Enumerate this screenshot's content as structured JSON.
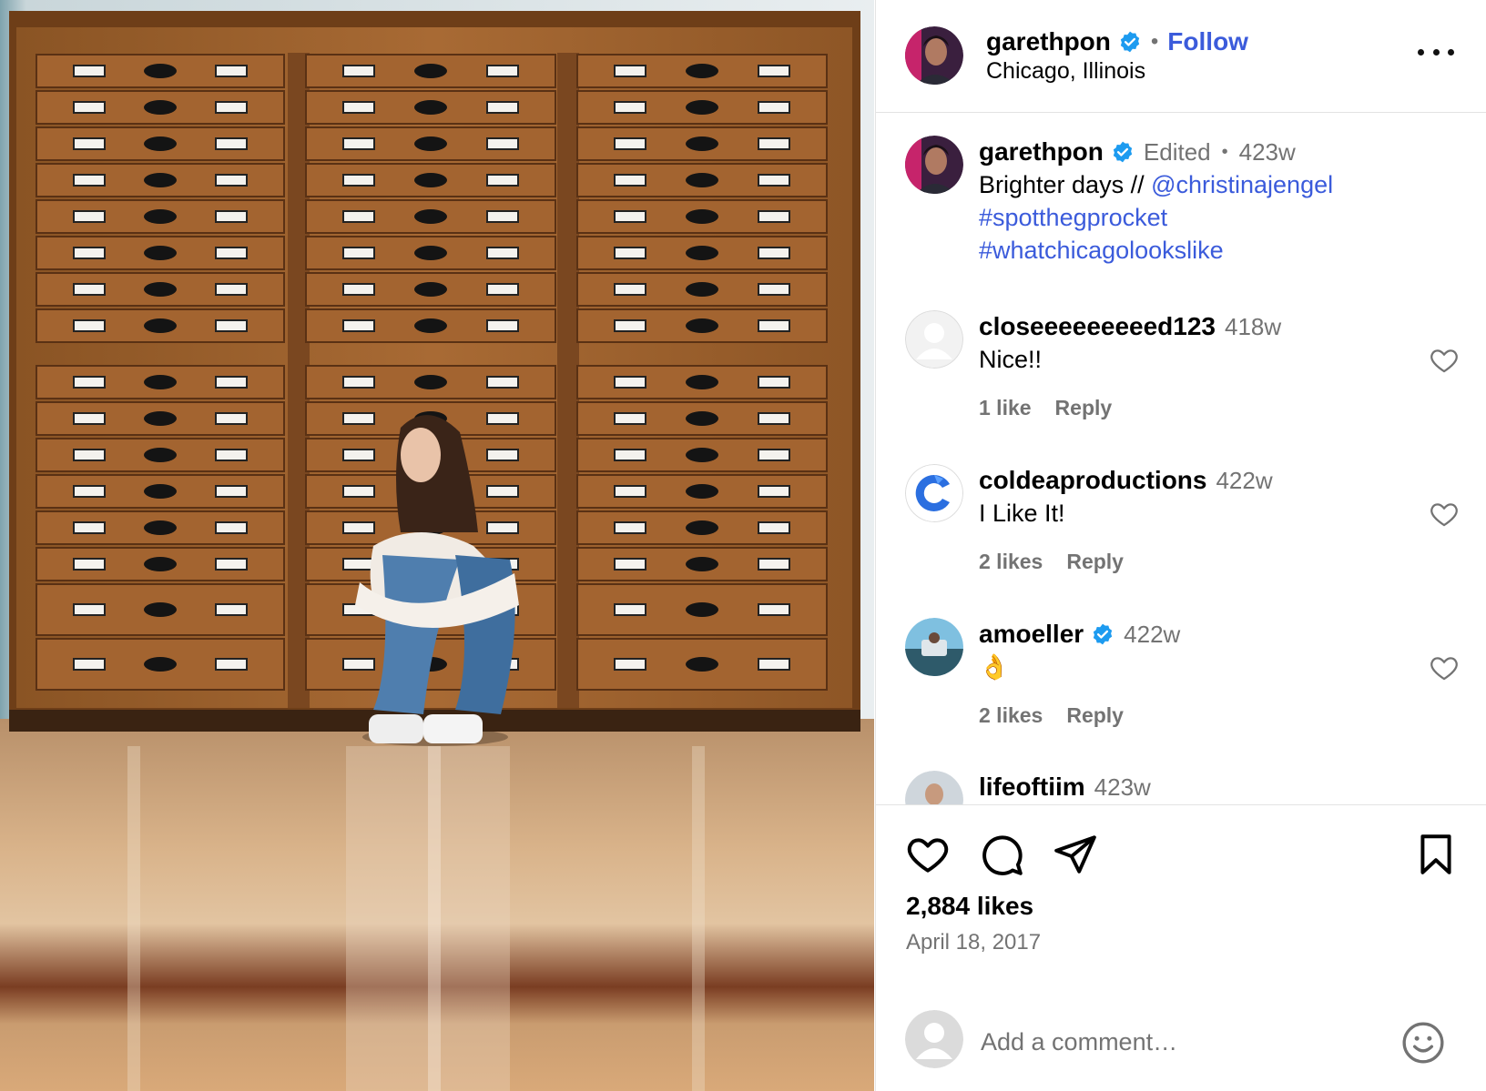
{
  "post": {
    "username": "garethpon",
    "follow_label": "Follow",
    "separator": "•",
    "location": "Chicago, Illinois",
    "more_icon": "more-horizontal-icon",
    "verified_icon": "verified-badge-icon"
  },
  "caption": {
    "username": "garethpon",
    "edited": "Edited",
    "separator": "•",
    "time": "423w",
    "text_prefix": "Brighter days // ",
    "mention": "@christinajengel",
    "hashtag1": "#spotthegprocket",
    "hashtag2": "#whatchicagolookslike"
  },
  "comments": [
    {
      "username": "closeeeeeeeeed123",
      "time": "418w",
      "text": "Nice!!",
      "likes": "1 like",
      "reply": "Reply",
      "verified": false
    },
    {
      "username": "coldeaproductions",
      "time": "422w",
      "text": "I Like It!",
      "likes": "2 likes",
      "reply": "Reply",
      "verified": false
    },
    {
      "username": "amoeller",
      "time": "422w",
      "text": "👌",
      "likes": "2 likes",
      "reply": "Reply",
      "verified": true
    },
    {
      "username": "lifeoftiim",
      "time": "423w",
      "text": "",
      "likes": "",
      "reply": "",
      "verified": false
    }
  ],
  "actions": {
    "like_icon": "heart-icon",
    "comment_icon": "comment-icon",
    "share_icon": "send-icon",
    "save_icon": "bookmark-icon"
  },
  "stats": {
    "likes": "2,884 likes",
    "date": "April 18, 2017"
  },
  "add_comment": {
    "placeholder": "Add a comment…",
    "emoji_icon": "emoji-smile-icon"
  },
  "colors": {
    "link": "#3b5bdb",
    "verified": "#1d9bf0",
    "muted": "#737373"
  }
}
